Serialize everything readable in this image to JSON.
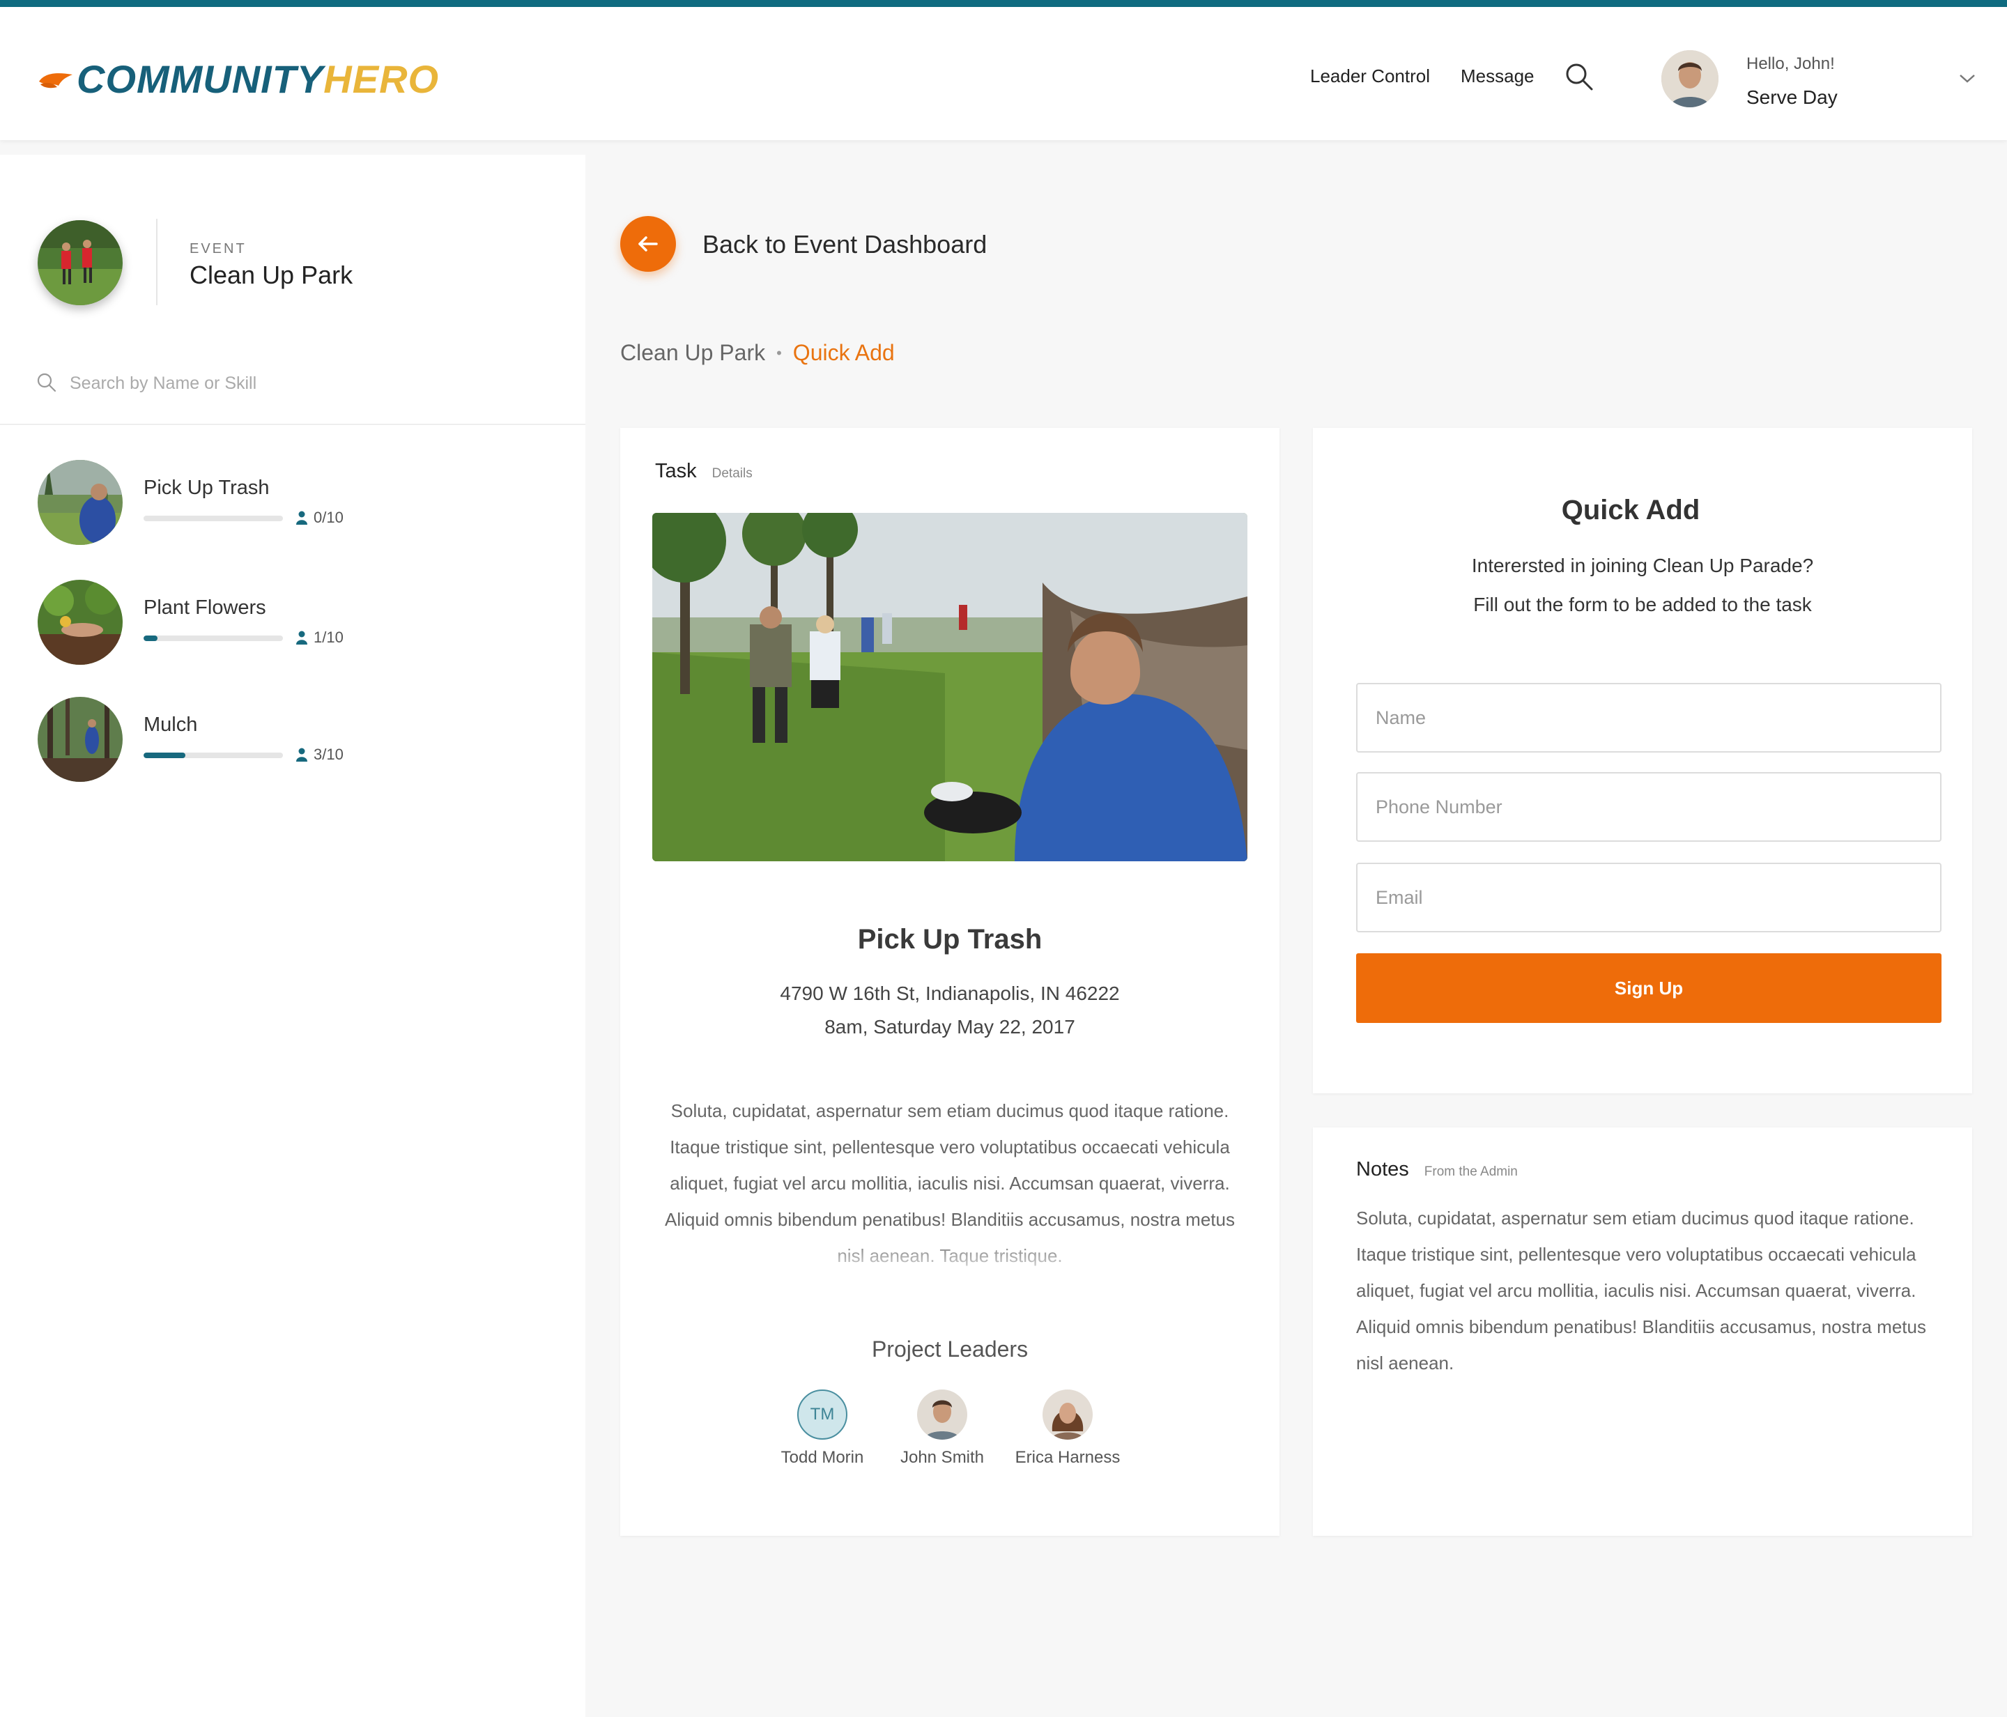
{
  "brand": {
    "part1": "COMMUNITY",
    "part2": "HERO",
    "primary_color": "#17607a",
    "secondary_color": "#e9b53a",
    "mark_color": "#ee6c0a"
  },
  "nav": {
    "leader_control": "Leader Control",
    "message": "Message",
    "search_icon": "search-icon"
  },
  "user": {
    "greeting": "Hello, John!",
    "org": "Serve Day",
    "menu_icon": "chevron-down-icon"
  },
  "sidebar": {
    "event_kicker": "EVENT",
    "event_name": "Clean Up Park",
    "search_placeholder": "Search by Name or Skill",
    "tasks": [
      {
        "title": "Pick Up Trash",
        "count": "0/10",
        "progress": 0
      },
      {
        "title": "Plant Flowers",
        "count": "1/10",
        "progress": 0.1
      },
      {
        "title": "Mulch",
        "count": "3/10",
        "progress": 0.3
      }
    ]
  },
  "main": {
    "back_label": "Back to Event Dashboard",
    "breadcrumb": {
      "parent": "Clean Up Park",
      "separator": "•",
      "current": "Quick Add"
    }
  },
  "task_card": {
    "head_title": "Task",
    "head_sub": "Details",
    "title": "Pick Up Trash",
    "address": "4790 W 16th St, Indianapolis, IN 46222",
    "when": "8am, Saturday May 22, 2017",
    "description": "Soluta, cupidatat, aspernatur sem etiam ducimus quod itaque ratione. Itaque tristique sint, pellentesque vero voluptatibus occaecati vehicula aliquet, fugiat vel arcu mollitia, iaculis nisi. Accumsan quaerat, viverra. Aliquid omnis bibendum penatibus! Blanditiis accusamus, nostra metus nisl aenean. Taque tristique.",
    "leaders_title": "Project Leaders",
    "leaders": [
      {
        "initials": "TM",
        "name": "Todd Morin"
      },
      {
        "name": "John Smith"
      },
      {
        "name": "Erica Harness"
      }
    ]
  },
  "quick_add": {
    "title": "Quick Add",
    "line1": "Interersted in joining Clean Up Parade?",
    "line2": "Fill out the form to be added to the task",
    "name_placeholder": "Name",
    "phone_placeholder": "Phone Number",
    "email_placeholder": "Email",
    "submit": "Sign Up"
  },
  "notes": {
    "title": "Notes",
    "sub": "From the Admin",
    "text": "Soluta, cupidatat, aspernatur sem etiam ducimus quod itaque ratione. Itaque tristique sint, pellentesque vero voluptatibus occaecati vehicula aliquet, fugiat vel arcu mollitia, iaculis nisi. Accumsan quaerat, viverra. Aliquid omnis bibendum penatibus! Blanditiis accusamus, nostra metus nisl aenean."
  },
  "colors": {
    "accent": "#ee6c0a",
    "teal": "#17697e",
    "breadcrumb_active": "#e97411"
  }
}
